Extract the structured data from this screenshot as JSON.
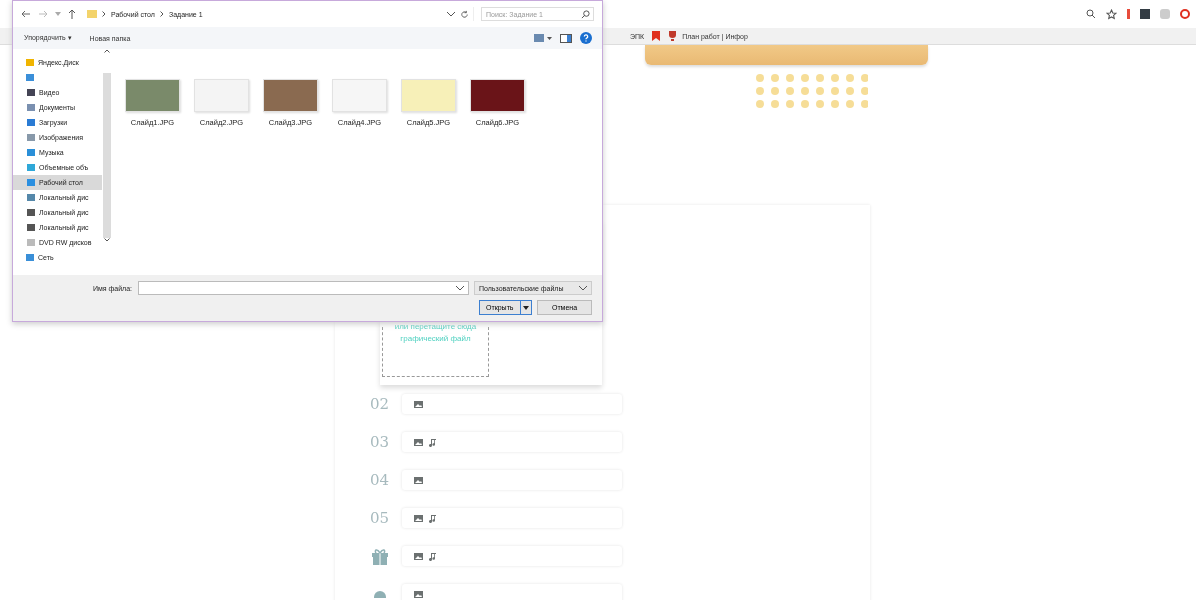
{
  "browser": {
    "bookmarks": [
      {
        "label": "ЭПК",
        "kind": "text"
      },
      {
        "kind": "bookmark"
      },
      {
        "label": "План работ | Инфор",
        "kind": "site"
      }
    ]
  },
  "page": {
    "drop_zone": {
      "text": "или перетащите сюда графический файл"
    },
    "rows": [
      {
        "kind": "number",
        "number": "02",
        "audio": false
      },
      {
        "kind": "number",
        "number": "03",
        "audio": true
      },
      {
        "kind": "number",
        "number": "04",
        "audio": false
      },
      {
        "kind": "number",
        "number": "05",
        "audio": true
      },
      {
        "kind": "gift",
        "number": "",
        "audio": true
      },
      {
        "kind": "pin",
        "number": "",
        "audio": false
      }
    ]
  },
  "dialog": {
    "breadcrumb": [
      "Рабочий стол",
      "Задание 1"
    ],
    "search": {
      "placeholder": "Поиск: Задание 1"
    },
    "toolbar": [
      "Упорядочить ▾",
      "Новая папка"
    ],
    "nav": [
      {
        "label": "Яндекс.Диск",
        "kind": "yadisk",
        "selected": false
      },
      {
        "kind": "computer",
        "selected": false
      },
      {
        "label": "Видео",
        "kind": "video",
        "selected": false
      },
      {
        "label": "Документы",
        "kind": "docs",
        "selected": false
      },
      {
        "label": "Загрузки",
        "kind": "download",
        "selected": false
      },
      {
        "label": "Изображения",
        "kind": "images",
        "selected": false
      },
      {
        "label": "Музыка",
        "kind": "music",
        "selected": false
      },
      {
        "label": "Объемные объ",
        "kind": "cube",
        "selected": false
      },
      {
        "label": "Рабочий стол",
        "kind": "desktop",
        "selected": true
      },
      {
        "label": "Локальный дис",
        "kind": "sysdisk",
        "selected": false
      },
      {
        "label": "Локальный дис",
        "kind": "disk",
        "selected": false
      },
      {
        "label": "Локальный дис",
        "kind": "disk",
        "selected": false
      },
      {
        "label": "DVD RW дисков",
        "kind": "dvd",
        "selected": false
      },
      {
        "label": "Сеть",
        "kind": "network",
        "selected": false
      }
    ],
    "files": [
      {
        "name": "Слайд1.JPG",
        "color": "#7a8a6a"
      },
      {
        "name": "Слайд2.JPG",
        "color": "#f4f4f4"
      },
      {
        "name": "Слайд3.JPG",
        "color": "#8a6a50"
      },
      {
        "name": "Слайд4.JPG",
        "color": "#f6f6f6"
      },
      {
        "name": "Слайд5.JPG",
        "color": "#f7f0b8"
      },
      {
        "name": "Слайд6.JPG",
        "color": "#6a1418"
      }
    ],
    "filename_label": "Имя файла:",
    "filter": "Пользовательские файлы",
    "open_button": "Открыть",
    "cancel_button": "Отмена"
  }
}
